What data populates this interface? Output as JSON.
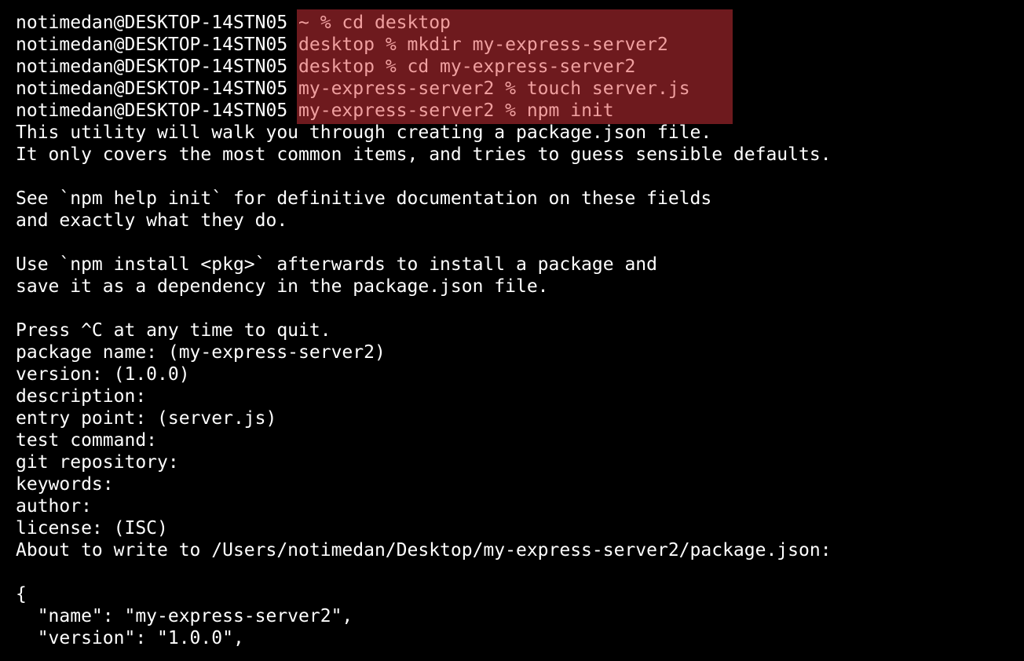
{
  "terminal": {
    "colors": {
      "background": "#000000",
      "text": "#ffffff",
      "highlight_bg": "#6e1a1e",
      "highlight_text": "#f0a0a0"
    },
    "prompts": [
      {
        "host": "notimedan@DESKTOP-14STN05",
        "command": "~ % cd desktop"
      },
      {
        "host": "notimedan@DESKTOP-14STN05",
        "command": "desktop % mkdir my-express-server2"
      },
      {
        "host": "notimedan@DESKTOP-14STN05",
        "command": "desktop % cd my-express-server2"
      },
      {
        "host": "notimedan@DESKTOP-14STN05",
        "command": "my-express-server2 % touch server.js"
      },
      {
        "host": "notimedan@DESKTOP-14STN05",
        "command": "my-express-server2 % npm init"
      }
    ],
    "output": [
      "This utility will walk you through creating a package.json file.",
      "It only covers the most common items, and tries to guess sensible defaults.",
      "",
      "See `npm help init` for definitive documentation on these fields",
      "and exactly what they do.",
      "",
      "Use `npm install <pkg>` afterwards to install a package and",
      "save it as a dependency in the package.json file.",
      "",
      "Press ^C at any time to quit.",
      "package name: (my-express-server2)",
      "version: (1.0.0)",
      "description:",
      "entry point: (server.js)",
      "test command:",
      "git repository:",
      "keywords:",
      "author:",
      "license: (ISC)",
      "About to write to /Users/notimedan/Desktop/my-express-server2/package.json:",
      "",
      "{",
      "  \"name\": \"my-express-server2\",",
      "  \"version\": \"1.0.0\","
    ]
  }
}
